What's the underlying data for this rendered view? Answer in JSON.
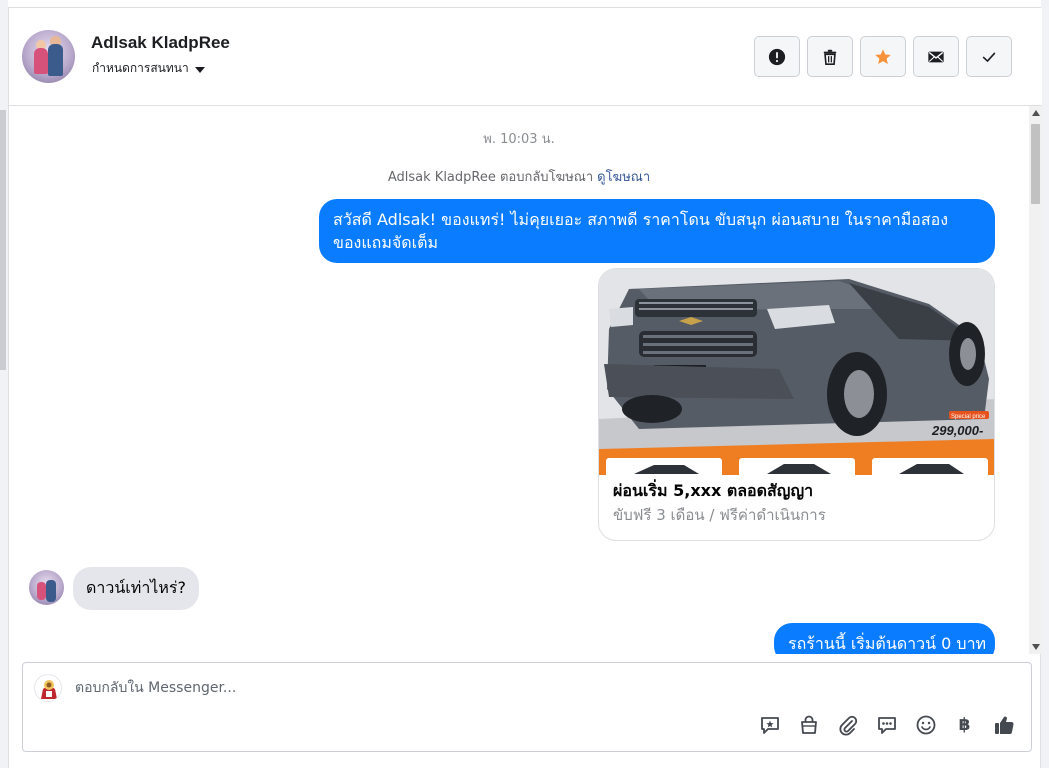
{
  "header": {
    "contact_name": "Adlsak KladpRee",
    "assign_label": "กำหนดการสนทนา",
    "actions": [
      {
        "name": "report-spam-button",
        "icon": "alert-circle-icon"
      },
      {
        "name": "delete-button",
        "icon": "trash-icon"
      },
      {
        "name": "star-button",
        "icon": "star-icon"
      },
      {
        "name": "mark-unread-button",
        "icon": "envelope-icon"
      },
      {
        "name": "mark-done-button",
        "icon": "checkmark-icon"
      }
    ]
  },
  "chat": {
    "timestamp": "พ. 10:03 น.",
    "ad_reply_text": "Adlsak KladpRee ตอบกลับโฆษณา",
    "ad_reply_link": "ดูโฆษณา",
    "messages": {
      "outgoing_1": "สวัสดี Adlsak! ของแทร่! ไม่คุยเยอะ สภาพดี ราคาโดน ขับสนุก ผ่อนสบาย ในราคามือสอง ของแถมจัดเต็ม",
      "card_title": "ผ่อนเริ่ม 5,xxx ตลอดสัญญา",
      "card_subtitle": "ขับฟรี 3 เดือน / ฟรีค่าดำเนินการ",
      "card_image_price_badge": "Special price",
      "card_image_price": "299,000-",
      "incoming_1": "ดาวน์เท่าไหร่?",
      "outgoing_2": "รถร้านนี้ เริ่มต้นดาวน์ 0 บาท"
    }
  },
  "composer": {
    "placeholder": "ตอบกลับใน Messenger...",
    "tools": [
      "saved-reply-icon",
      "shopping-bag-icon",
      "paperclip-icon",
      "chat-bubble-icon",
      "smiley-icon",
      "baht-icon",
      "thumbs-up-icon"
    ],
    "baht_symbol": "฿"
  },
  "colors": {
    "outgoing_bubble": "#0a7cff",
    "incoming_bubble": "#e4e6eb",
    "star": "#f7923b",
    "link": "#385898"
  }
}
